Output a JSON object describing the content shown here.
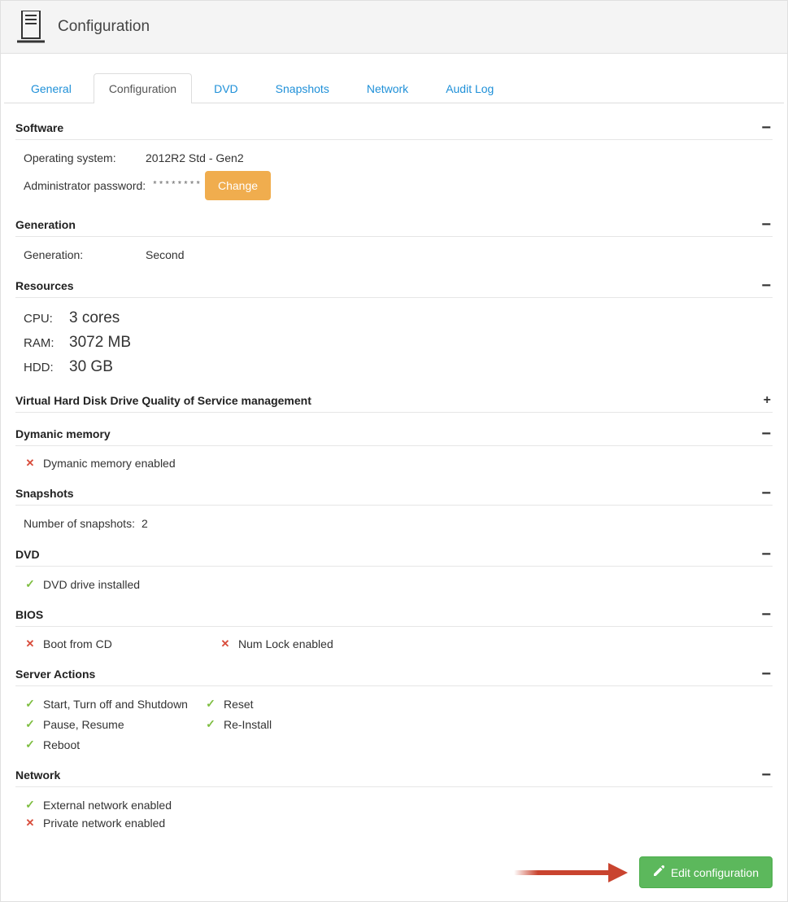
{
  "header": {
    "title": "Configuration"
  },
  "tabs": {
    "items": [
      "General",
      "Configuration",
      "DVD",
      "Snapshots",
      "Network",
      "Audit Log"
    ],
    "active": "Configuration"
  },
  "sections": {
    "software": {
      "title": "Software",
      "os_label": "Operating system:",
      "os_value": "2012R2 Std - Gen2",
      "pwd_label": "Administrator password:",
      "pwd_mask": "********",
      "change_label": "Change"
    },
    "generation": {
      "title": "Generation",
      "label": "Generation:",
      "value": "Second"
    },
    "resources": {
      "title": "Resources",
      "cpu_label": "CPU:",
      "cpu_value": "3 cores",
      "ram_label": "RAM:",
      "ram_value": "3072 MB",
      "hdd_label": "HDD:",
      "hdd_value": "30 GB"
    },
    "vhd_qos": {
      "title": "Virtual Hard Disk Drive Quality of Service management"
    },
    "dyn_mem": {
      "title": "Dymanic memory",
      "item": "Dymanic memory enabled",
      "enabled": false
    },
    "snapshots": {
      "title": "Snapshots",
      "label": "Number of snapshots:",
      "value": "2"
    },
    "dvd": {
      "title": "DVD",
      "item": "DVD drive installed",
      "installed": true
    },
    "bios": {
      "title": "BIOS",
      "boot_cd": {
        "label": "Boot from CD",
        "enabled": false
      },
      "num_lock": {
        "label": "Num Lock enabled",
        "enabled": false
      }
    },
    "actions": {
      "title": "Server Actions",
      "col1": [
        {
          "label": "Start, Turn off and Shutdown",
          "enabled": true
        },
        {
          "label": "Pause, Resume",
          "enabled": true
        },
        {
          "label": "Reboot",
          "enabled": true
        }
      ],
      "col2": [
        {
          "label": "Reset",
          "enabled": true
        },
        {
          "label": "Re-Install",
          "enabled": true
        }
      ]
    },
    "network": {
      "title": "Network",
      "external": {
        "label": "External network enabled",
        "enabled": true
      },
      "private": {
        "label": "Private network enabled",
        "enabled": false
      }
    }
  },
  "footer": {
    "edit_label": "Edit configuration"
  }
}
